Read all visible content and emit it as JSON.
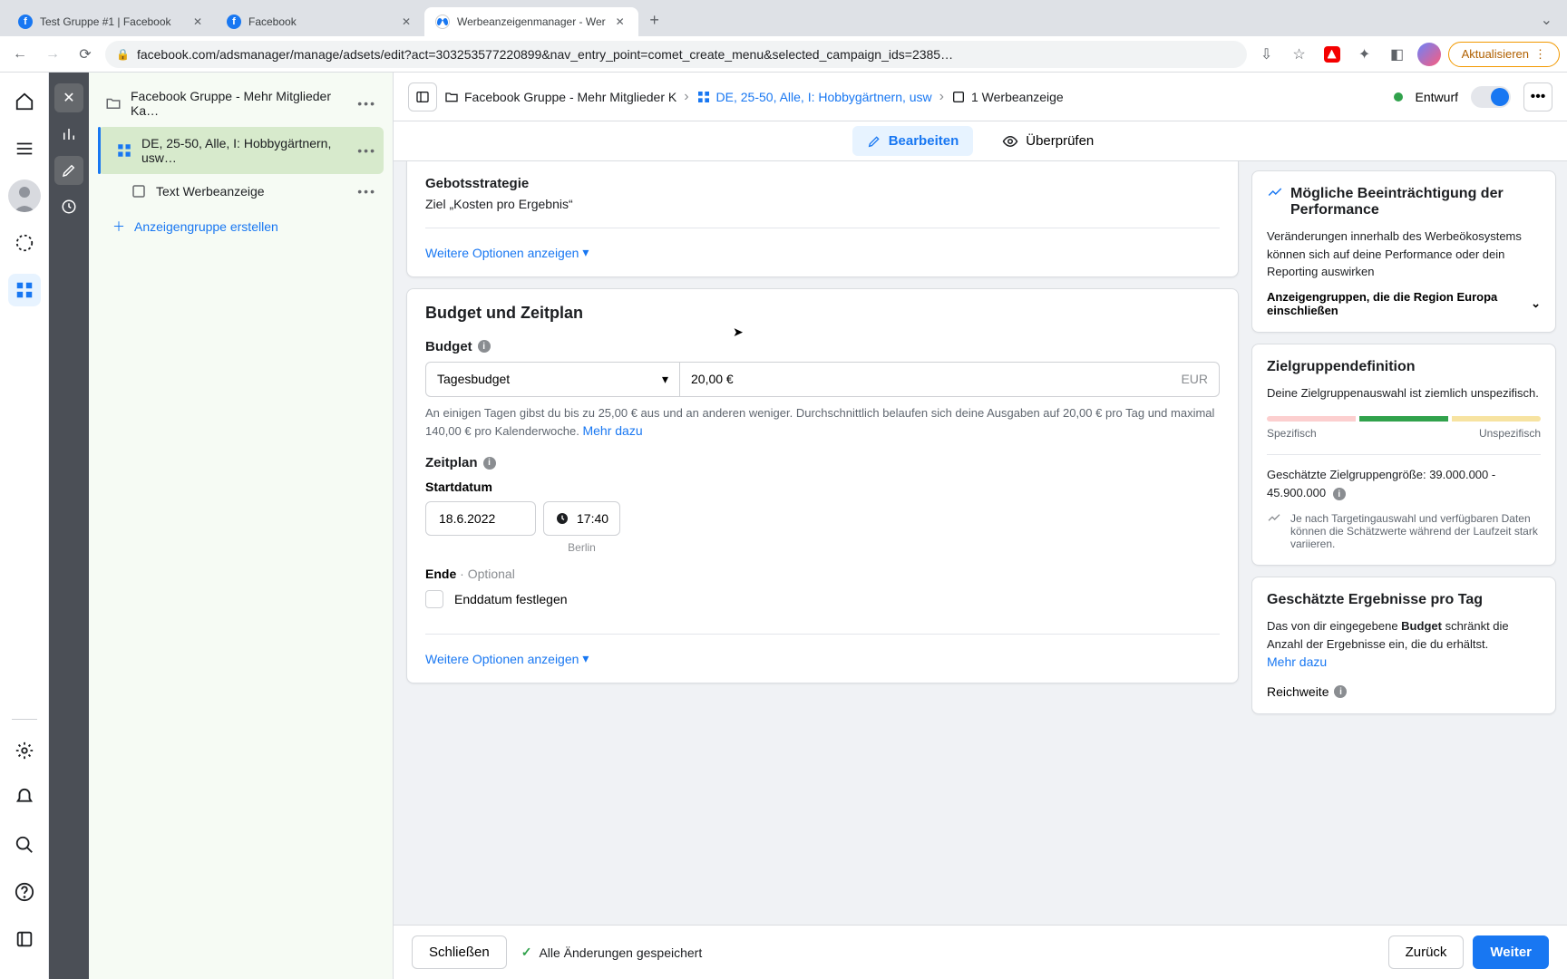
{
  "browser": {
    "tabs": [
      {
        "title": "Test Gruppe #1 | Facebook",
        "active": false
      },
      {
        "title": "Facebook",
        "active": false
      },
      {
        "title": "Werbeanzeigenmanager - Wer",
        "active": true
      }
    ],
    "url": "facebook.com/adsmanager/manage/adsets/edit?act=303253577220899&nav_entry_point=comet_create_menu&selected_campaign_ids=2385…",
    "update_label": "Aktualisieren"
  },
  "tree": {
    "campaign": "Facebook Gruppe - Mehr Mitglieder Ka…",
    "adset": "DE, 25-50, Alle, I: Hobbygärtnern, usw…",
    "ad": "Text Werbeanzeige",
    "create_label": "Anzeigengruppe erstellen"
  },
  "breadcrumb": {
    "campaign": "Facebook Gruppe - Mehr Mitglieder K",
    "adset": "DE, 25-50, Alle, I: Hobbygärtnern, usw",
    "ad": "1 Werbeanzeige",
    "draft": "Entwurf"
  },
  "subbar": {
    "edit": "Bearbeiten",
    "review": "Überprüfen"
  },
  "bidding": {
    "heading": "Gebotsstrategie",
    "value": "Ziel „Kosten pro Ergebnis“",
    "more": "Weitere Optionen anzeigen"
  },
  "budget": {
    "section": "Budget und Zeitplan",
    "label": "Budget",
    "type": "Tagesbudget",
    "amount": "20,00 €",
    "currency": "EUR",
    "helper": "An einigen Tagen gibst du bis zu 25,00 € aus und an anderen weniger. Durchschnittlich belaufen sich deine Ausgaben auf 20,00 € pro Tag und maximal 140,00 € pro Kalenderwoche. ",
    "helper_link": "Mehr dazu",
    "schedule_label": "Zeitplan",
    "start_label": "Startdatum",
    "start_date": "18.6.2022",
    "start_time": "17:40",
    "timezone": "Berlin",
    "end_label": "Ende",
    "end_optional": "Optional",
    "end_checkbox": "Enddatum festlegen",
    "more2": "Weitere Optionen anzeigen"
  },
  "right": {
    "perf_title": "Mögliche Beeinträchtigung der Performance",
    "perf_body": "Veränderungen innerhalb des Werbeökosystems können sich auf deine Performance oder dein Reporting auswirken",
    "perf_accordion": "Anzeigengruppen, die die Region Europa einschließen",
    "audience_title": "Zielgruppendefinition",
    "audience_body": "Deine Zielgruppenauswahl ist ziemlich unspezifisch.",
    "meter_left": "Spezifisch",
    "meter_right": "Unspezifisch",
    "size_label": "Geschätzte Zielgruppengröße: 39.000.000 - 45.900.000",
    "size_note": "Je nach Targetingauswahl und verfügbaren Daten können die Schätzwerte während der Laufzeit stark variieren.",
    "results_title": "Geschätzte Ergebnisse pro Tag",
    "results_body_a": "Das von dir eingegebene ",
    "results_body_b": "Budget",
    "results_body_c": " schränkt die Anzahl der Ergebnisse ein, die du erhältst. ",
    "results_link": "Mehr dazu",
    "reach_label": "Reichweite"
  },
  "footer": {
    "close": "Schließen",
    "saved": "Alle Änderungen gespeichert",
    "back": "Zurück",
    "next": "Weiter"
  }
}
